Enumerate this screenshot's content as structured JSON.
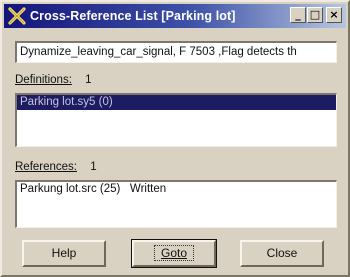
{
  "window": {
    "title": "Cross-Reference List [Parking lot]",
    "title_buttons": {
      "minimize": "_",
      "maximize": "□",
      "close": "×"
    }
  },
  "description": "Dynamize_leaving_car_signal, F 7503 ,Flag detects th",
  "definitions": {
    "label": "Definitions:",
    "count": "1",
    "items": [
      "Parking lot.sy5 (0)"
    ],
    "selected_index": 0
  },
  "references": {
    "label": "References:",
    "count": "1",
    "items": [
      "Parkung lot.src (25)   Written"
    ]
  },
  "buttons": {
    "help": "Help",
    "goto": "Goto",
    "close": "Close"
  },
  "colors": {
    "titlebar_start": "#14147a",
    "titlebar_end": "#b7c7e0",
    "selection": "#1c1c62"
  },
  "icons": {
    "app": "x-cross-icon"
  }
}
